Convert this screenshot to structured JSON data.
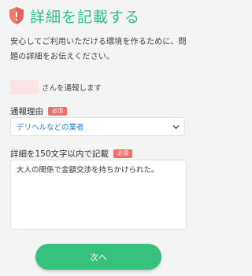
{
  "header": {
    "title": "詳細を記載する",
    "icon": "shield-icon",
    "accent_color": "#2fbf8c"
  },
  "intro": {
    "text": "安心してご利用いただける環境を作るために、問題の詳細をお伝えください。"
  },
  "target": {
    "suffix_text": "さんを通報します"
  },
  "reason": {
    "label": "通報理由",
    "required_badge": "必須",
    "selected_value": "デリヘルなどの業者",
    "icon": "chevron-down-icon"
  },
  "details": {
    "label": "詳細を150文字以内で記載",
    "required_badge": "必須",
    "value": "大人の関係で金額交渉を持ちかけられた。"
  },
  "footer": {
    "next_label": "次へ",
    "button_color": "#36c27d"
  },
  "colors": {
    "required_badge": "#ef6d6d",
    "select_text": "#2a7fd8"
  }
}
